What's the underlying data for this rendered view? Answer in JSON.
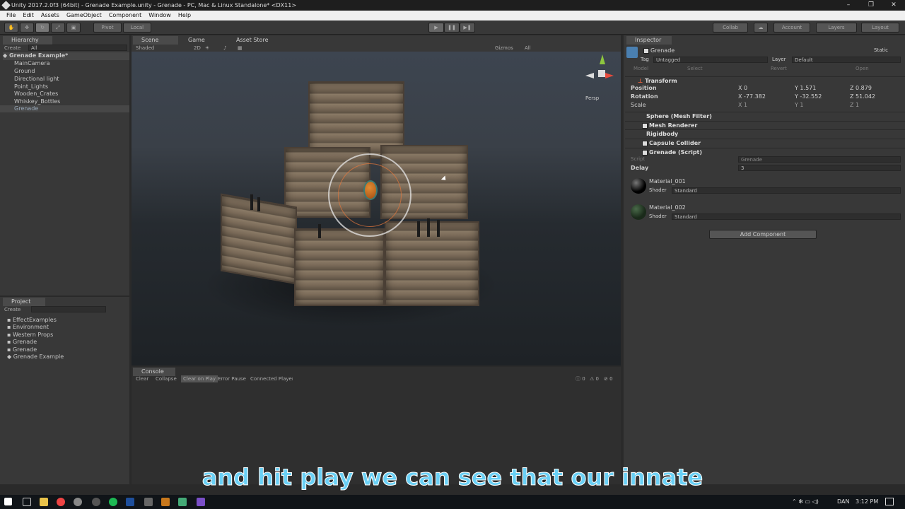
{
  "window": {
    "title": "Unity 2017.2.0f3 (64bit) - Grenade Example.unity - Grenade - PC, Mac & Linux Standalone* <DX11>"
  },
  "menu": [
    "File",
    "Edit",
    "Assets",
    "GameObject",
    "Component",
    "Window",
    "Help"
  ],
  "toolbar": {
    "pivot": "Pivot",
    "local": "Local",
    "collab": "Collab",
    "account": "Account",
    "layers": "Layers",
    "layout": "Layout"
  },
  "hierarchy": {
    "tab": "Hierarchy",
    "create": "Create",
    "search": "All",
    "scene": "Grenade Example*",
    "items": [
      "MainCamera",
      "Ground",
      "Directional light",
      "Point_Lights",
      "Wooden_Crates",
      "Whiskey_Bottles",
      "Grenade"
    ]
  },
  "scene_tabs": [
    "Scene",
    "Game",
    "Asset Store"
  ],
  "scene_bar": {
    "shaded": "Shaded",
    "twod": "2D",
    "gizmos": "Gizmos",
    "all": "All",
    "persp": "Persp"
  },
  "project": {
    "tab": "Project",
    "create": "Create",
    "items": [
      "EffectExamples",
      "Environment",
      "Western Props",
      "Grenade",
      "Grenade",
      "Grenade Example"
    ]
  },
  "console": {
    "tab": "Console",
    "buttons": [
      "Clear",
      "Collapse",
      "Clear on Play",
      "Error Pause",
      "Connected Player"
    ],
    "counts": [
      "0",
      "0",
      "0"
    ]
  },
  "inspector": {
    "tab": "Inspector",
    "name": "Grenade",
    "static": "Static",
    "tag_label": "Tag",
    "tag": "Untagged",
    "layer_label": "Layer",
    "layer": "Default",
    "model_label": "Model",
    "select": "Select",
    "revert": "Revert",
    "open": "Open",
    "transform": "Transform",
    "position": "Position",
    "rotation": "Rotation",
    "scale": "Scale",
    "pos": [
      "X 0",
      "Y 1.571",
      "Z 0.879"
    ],
    "rot": [
      "X -77.382",
      "Y -32.552",
      "Z 51.042"
    ],
    "scl": [
      "X 1",
      "Y 1",
      "Z 1"
    ],
    "components": [
      "Sphere (Mesh Filter)",
      "Mesh Renderer",
      "Rigidbody",
      "Capsule Collider",
      "Grenade (Script)"
    ],
    "script_label": "Script",
    "script_value": "Grenade",
    "delay_label": "Delay",
    "delay_value": "3",
    "materials": [
      {
        "name": "Material_001",
        "shader_label": "Shader",
        "shader": "Standard"
      },
      {
        "name": "Material_002",
        "shader_label": "Shader",
        "shader": "Standard"
      }
    ],
    "add_component": "Add Component"
  },
  "subtitle": "and hit play we can see that our innate",
  "taskbar": {
    "lang": "DAN",
    "time": "3:12 PM"
  }
}
